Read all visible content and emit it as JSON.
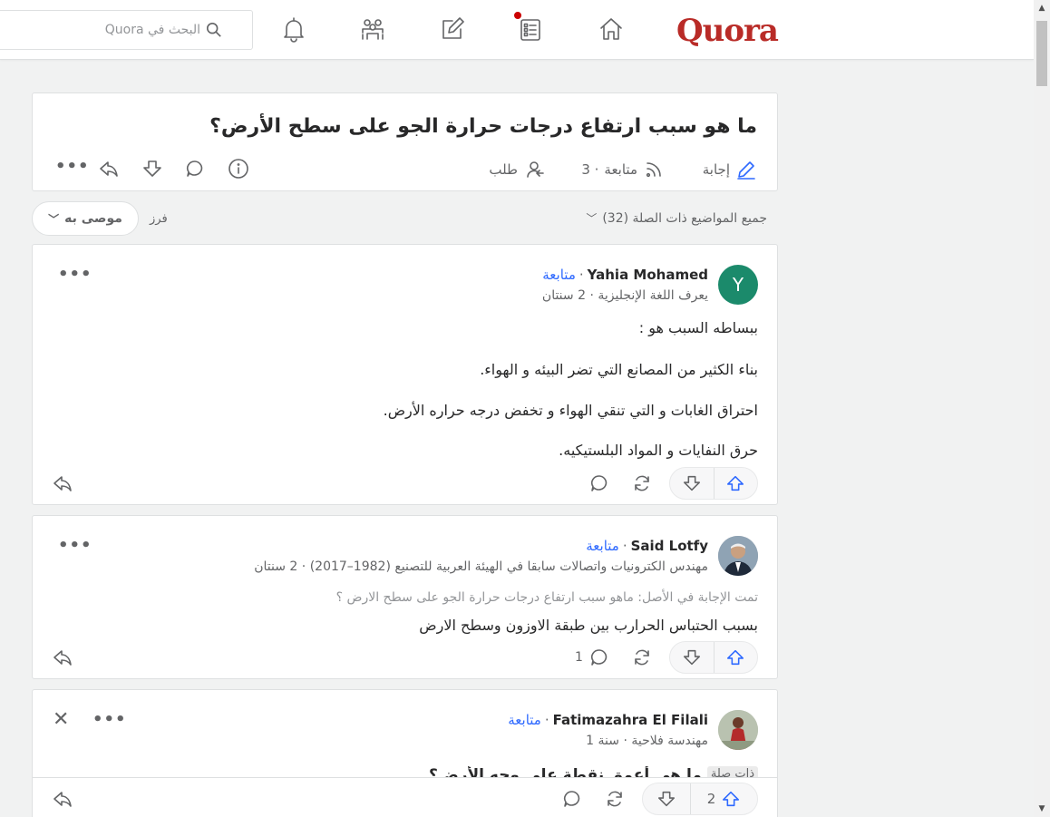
{
  "header": {
    "logo": "Quora",
    "search_placeholder": "البحث في Quora"
  },
  "question": {
    "title": "ما هو سبب ارتفاع درجات حرارة الجو على سطح الأرض؟",
    "answer_label": "إجابة",
    "follow_label": "متابعة",
    "follow_count": "· 3",
    "request_label": "طلب"
  },
  "filters": {
    "topics_label": "جميع المواضيع ذات الصلة (32)",
    "sort_label": "فرز",
    "sort_value": "موصى به"
  },
  "answers": [
    {
      "author": "Yahia Mohamed",
      "follow": "متابعة",
      "avatar_letter": "Y",
      "avatar_color": "#1b8a6b",
      "credential": "يعرف اللغة الإنجليزية · 2 سنتان",
      "paragraphs": [
        "ببساطه السبب هو :",
        "بناء الكثير من المصانع التي تضر البيئه و الهواء.",
        "احتراق الغابات و التي تنقي الهواء و تخفض درجه حراره الأرض.",
        "حرق النفايات و المواد البلستيكيه."
      ],
      "comment_count": "",
      "upvote_count": ""
    },
    {
      "author": "Said Lotfy",
      "follow": "متابعة",
      "credential": "مهندس الكترونيات واتصالات سابقا في الهيئة العربية للتصنيع (1982–2017) · 2 سنتان",
      "original_question": "تمت الإجابة في الأصل: ماهو سبب ارتفاع درجات حرارة الجو على سطح الارض ؟",
      "paragraphs": [
        "بسبب الحتباس الحرارب بين طبقة الاوزون وسطح الارض"
      ],
      "comment_count": "1",
      "upvote_count": ""
    },
    {
      "author": "Fatimazahra El Filali",
      "follow": "متابعة",
      "credential": "مهندسة فلاحية · سنة 1",
      "related_tag": "ذات صلة",
      "related_title": "ما هي أعمق نقطة على وجه الأرض؟",
      "comment_count": "",
      "upvote_count": "2"
    }
  ]
}
